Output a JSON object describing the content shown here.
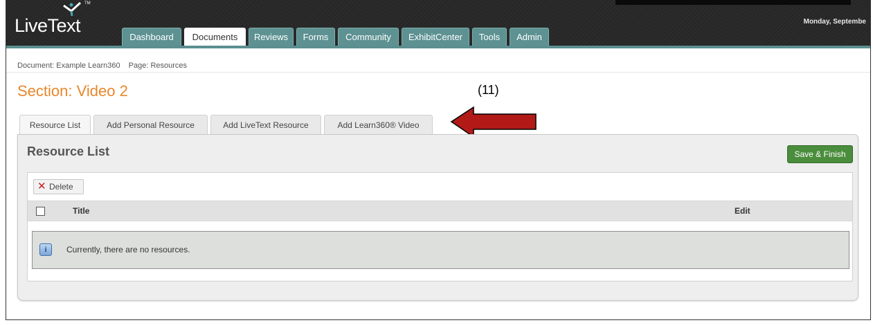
{
  "app": {
    "logo_text": "LiveText",
    "logo_tm": "TM",
    "date_text": "Monday, Septembe"
  },
  "nav": {
    "tabs": [
      {
        "label": "Dashboard"
      },
      {
        "label": "Documents",
        "active": true
      },
      {
        "label": "Reviews"
      },
      {
        "label": "Forms"
      },
      {
        "label": "Community"
      },
      {
        "label": "ExhibitCenter"
      },
      {
        "label": "Tools"
      },
      {
        "label": "Admin"
      }
    ]
  },
  "breadcrumb": {
    "document": "Document: Example Learn360",
    "page": "Page: Resources"
  },
  "section_title": "Section: Video 2",
  "annotation": "(11)",
  "subtabs": [
    {
      "label": "Resource List",
      "active": true
    },
    {
      "label": "Add Personal Resource"
    },
    {
      "label": "Add LiveText Resource"
    },
    {
      "label": "Add Learn360® Video"
    }
  ],
  "panel": {
    "title": "Resource List",
    "save_label": "Save & Finish",
    "delete_label": "Delete",
    "columns": [
      "Title",
      "Edit"
    ],
    "empty_message": "Currently, there are no resources.",
    "info_glyph": "i"
  },
  "colors": {
    "accent_orange": "#e8872a",
    "nav_teal": "#5d9192",
    "save_green": "#4a8d3c",
    "arrow_red": "#b11a17"
  }
}
